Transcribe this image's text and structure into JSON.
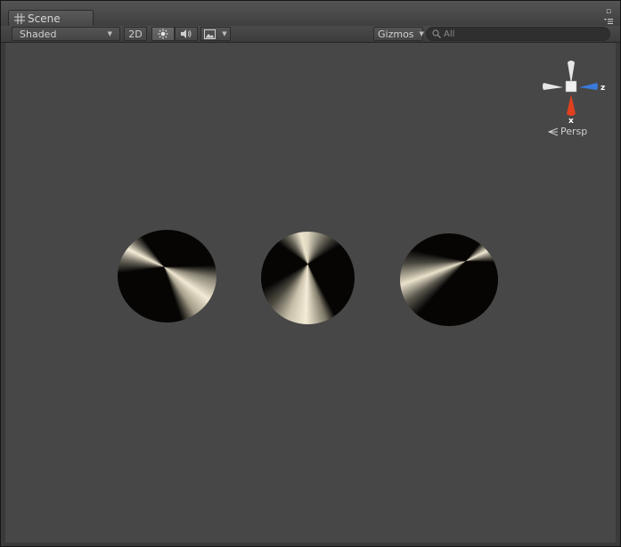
{
  "window": {
    "tab_label": "Scene",
    "tab_icon": "scene-grid-icon"
  },
  "toolbar": {
    "draw_mode": "Shaded",
    "mode_2d": "2D",
    "lighting_icon": "sun-icon",
    "audio_icon": "speaker-icon",
    "effects_icon": "image-icon",
    "gizmos_label": "Gizmos",
    "search_placeholder": "All"
  },
  "scene_gizmo": {
    "x_label": "x",
    "z_label": "z",
    "projection_label": "Persp",
    "colors": {
      "x": "#e0401e",
      "y": "#e8e8e8",
      "z": "#3a7ad8"
    }
  },
  "colors": {
    "viewport_background": "#474747",
    "disc_dark": "#050403",
    "disc_highlight": "#eee6cf"
  }
}
